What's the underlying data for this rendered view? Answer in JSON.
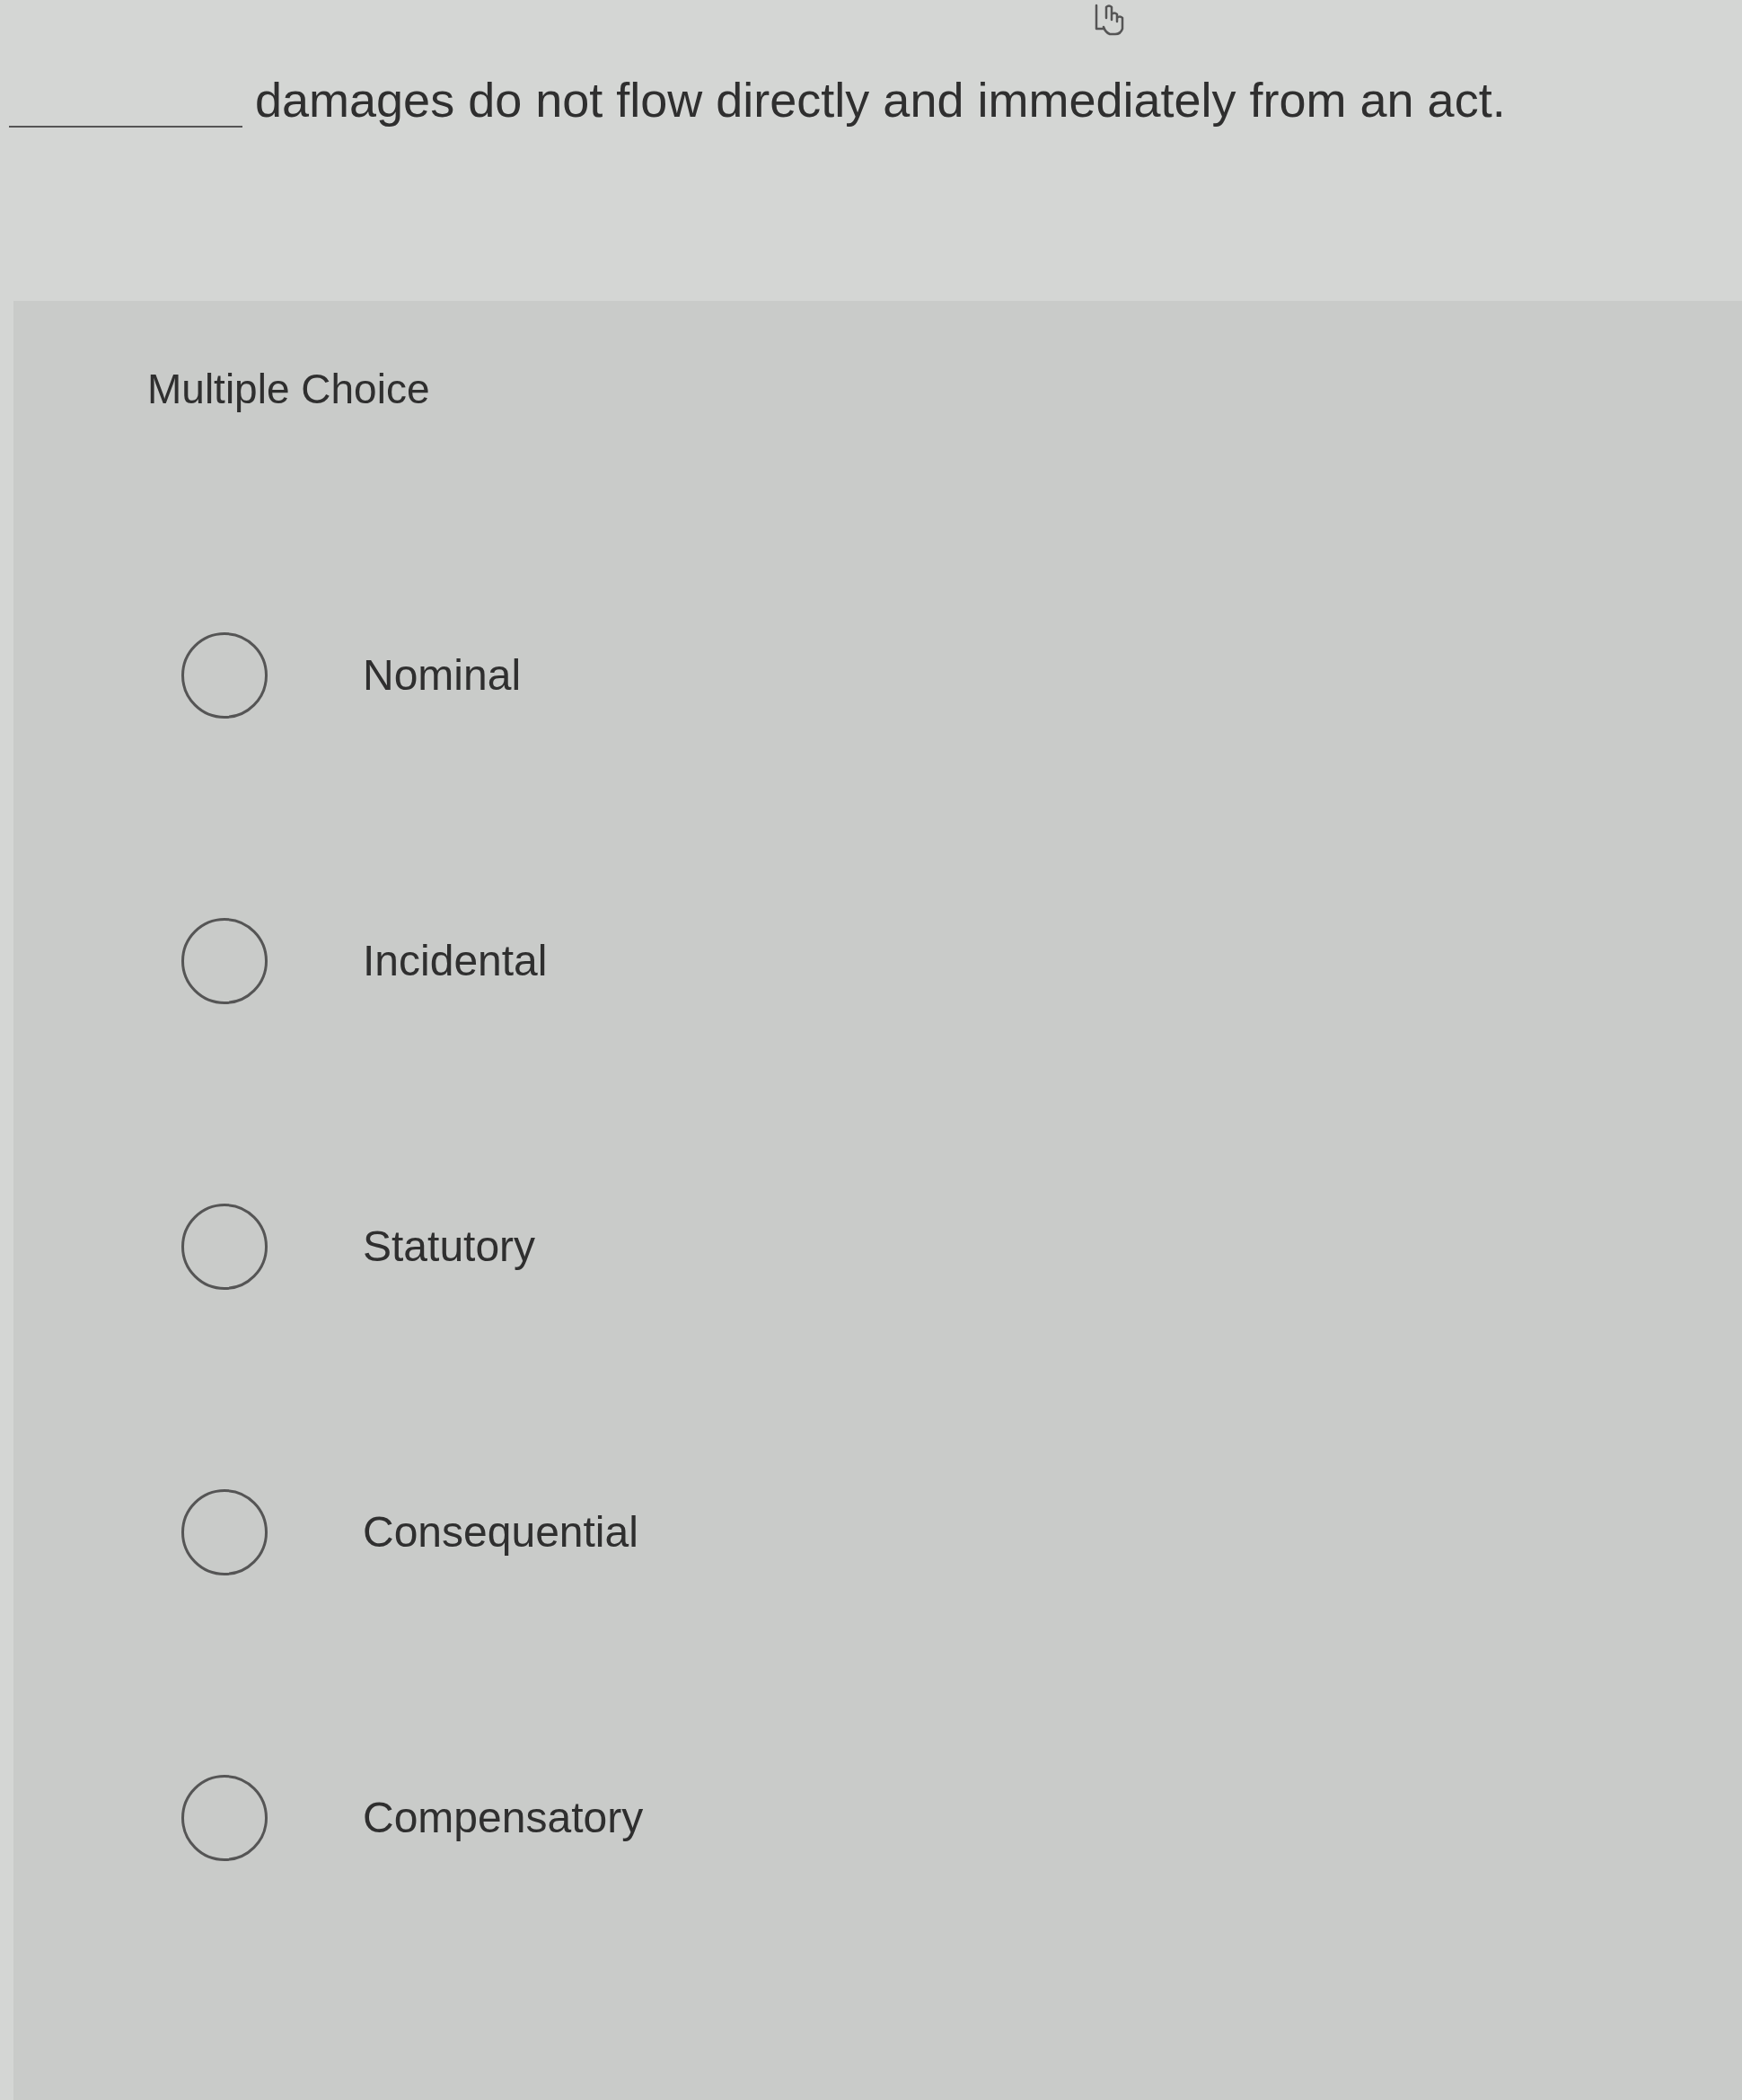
{
  "question": {
    "text": "damages do not flow directly and immediately from an act."
  },
  "choice_type": "Multiple Choice",
  "options": [
    {
      "label": "Nominal",
      "selected": false
    },
    {
      "label": "Incidental",
      "selected": false
    },
    {
      "label": "Statutory",
      "selected": false
    },
    {
      "label": "Consequential",
      "selected": false
    },
    {
      "label": "Compensatory",
      "selected": false
    }
  ]
}
